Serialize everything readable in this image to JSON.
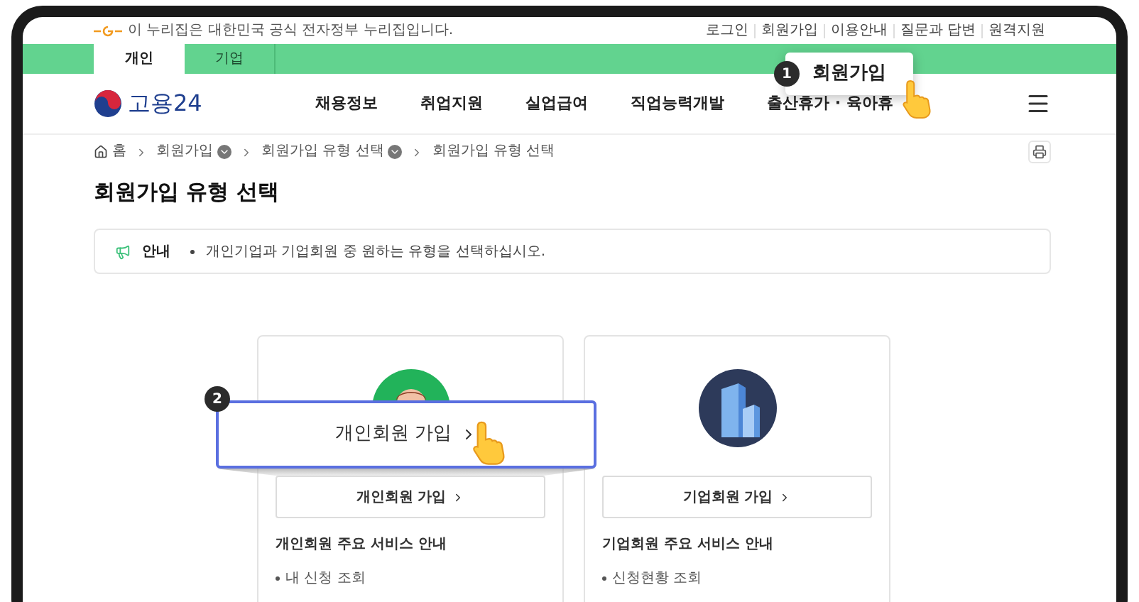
{
  "notice_bar": {
    "text": "이 누리집은 대한민국 공식 전자정부 누리집입니다."
  },
  "utility_links": [
    "로그인",
    "회원가입",
    "이용안내",
    "질문과 답변",
    "원격지원"
  ],
  "audience_tabs": [
    {
      "label": "개인",
      "selected": true
    },
    {
      "label": "기업",
      "selected": false
    }
  ],
  "logo": {
    "text": "고용24"
  },
  "nav": [
    "채용정보",
    "취업지원",
    "실업급여",
    "직업능력개발",
    "출산휴가 · 육아휴"
  ],
  "breadcrumb": [
    {
      "label": "홈",
      "kind": "home",
      "dropdown": false
    },
    {
      "label": "회원가입",
      "kind": "link",
      "dropdown": true
    },
    {
      "label": "회원가입 유형 선택",
      "kind": "link",
      "dropdown": true
    },
    {
      "label": "회원가입 유형 선택",
      "kind": "link",
      "dropdown": false
    }
  ],
  "page_title": "회원가입 유형 선택",
  "notice": {
    "label": "안내",
    "text": "개인기업과 기업회원 중 원하는 유형을 선택하십시오."
  },
  "cards": [
    {
      "kind": "person",
      "button": "개인회원 가입",
      "services_title": "개인회원 주요 서비스 안내",
      "services": [
        "내 신청 조회"
      ]
    },
    {
      "kind": "company",
      "button": "기업회원 가입",
      "services_title": "기업회원 주요 서비스 안내",
      "services": [
        "신청현황 조회"
      ]
    }
  ],
  "callouts": [
    {
      "number": "1",
      "text": "회원가입"
    },
    {
      "number": "2",
      "text": "개인회원 가입"
    }
  ]
}
